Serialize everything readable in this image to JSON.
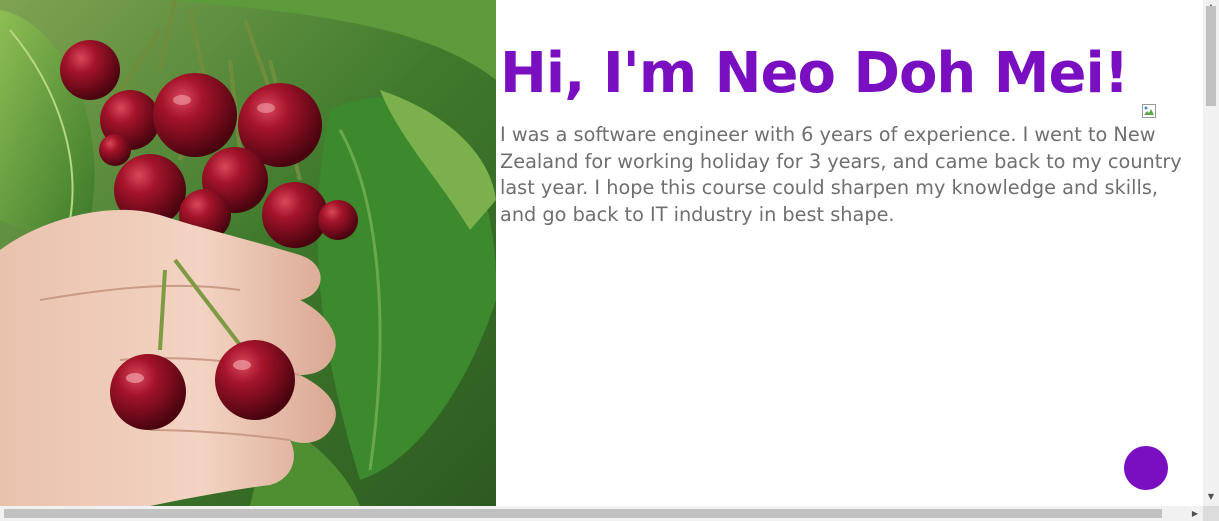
{
  "profile": {
    "heading": "Hi, I'm Neo Doh Mei!",
    "bio": "I was a software engineer with 6 years of experience. I went to New Zealand for working holiday for 3 years, and came back to my country last year. I hope this course could sharpen my knowledge and skills, and go back to IT industry in best shape."
  },
  "photo": {
    "subject": "cherries-in-hand"
  },
  "colors": {
    "accent": "#7a0fc2",
    "body_text": "#6f6f6f",
    "background": "#ffffff"
  },
  "icons": {
    "broken_image": "broken-image-icon",
    "fab": "circle-button",
    "scroll_up": "arrow-up-icon",
    "scroll_down": "arrow-down-icon",
    "scroll_left": "arrow-left-icon",
    "scroll_right": "arrow-right-icon"
  }
}
